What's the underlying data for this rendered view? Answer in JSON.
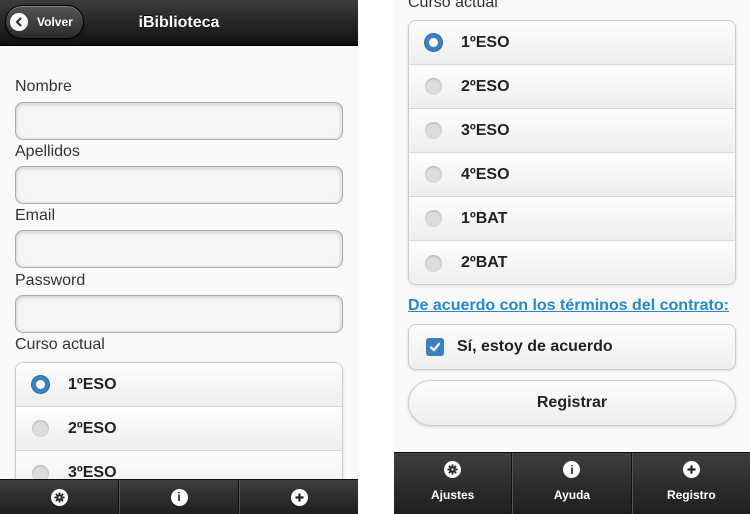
{
  "header": {
    "title": "iBiblioteca",
    "back_label": "Volver"
  },
  "form": {
    "fields": [
      {
        "label": "Nombre",
        "value": ""
      },
      {
        "label": "Apellidos",
        "value": ""
      },
      {
        "label": "Email",
        "value": ""
      },
      {
        "label": "Password",
        "value": ""
      }
    ],
    "course_label": "Curso actual",
    "courses": [
      {
        "label": "1ºESO",
        "selected": true
      },
      {
        "label": "2ºESO",
        "selected": false
      },
      {
        "label": "3ºESO",
        "selected": false
      },
      {
        "label": "4ºESO",
        "selected": false
      },
      {
        "label": "1ºBAT",
        "selected": false
      },
      {
        "label": "2ºBAT",
        "selected": false
      }
    ],
    "terms_label": "De acuerdo con los términos del contrato:",
    "terms_checkbox_label": "Sí, estoy de acuerdo",
    "terms_checked": true,
    "register_label": "Registrar"
  },
  "navbar": {
    "items": [
      {
        "label": "Ajustes",
        "icon": "gear-icon"
      },
      {
        "label": "Ayuda",
        "icon": "info-icon"
      },
      {
        "label": "Registro",
        "icon": "plus-icon"
      }
    ]
  },
  "colors": {
    "header": "#1f1f1f",
    "accent": "#3a82c4",
    "link": "#2489ce",
    "background": "#f9f9f9"
  }
}
